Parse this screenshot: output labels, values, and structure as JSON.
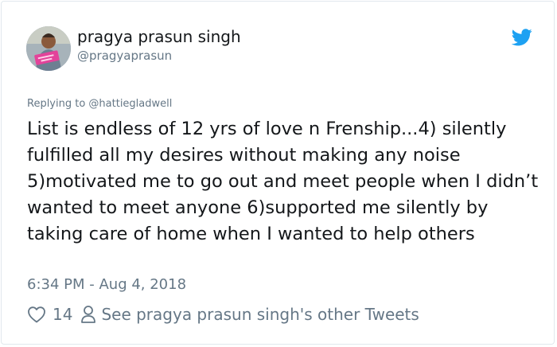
{
  "tweet": {
    "author_name": "pragya prasun singh",
    "author_handle": "@pragyaprasun",
    "reply_to_label": "Replying to @hattiegladwell",
    "text": "List is endless of 12 yrs of love n Frenship...4) silently fulfilled all my desires without making any noise 5)motivated me to go out and meet people when I didn’t wanted to meet anyone 6)supported me silently by taking care of home when I wanted to help others",
    "timestamp": "6:34 PM - Aug 4, 2018",
    "like_count": "14",
    "other_tweets_link": "See pragya prasun singh's other Tweets"
  },
  "icons": {
    "brand": "twitter-bird-icon",
    "like": "heart-outline-icon",
    "profile": "person-outline-icon"
  },
  "colors": {
    "brand": "#1da1f2",
    "muted": "#657786",
    "text": "#14171a",
    "border": "#e1e8ed"
  }
}
